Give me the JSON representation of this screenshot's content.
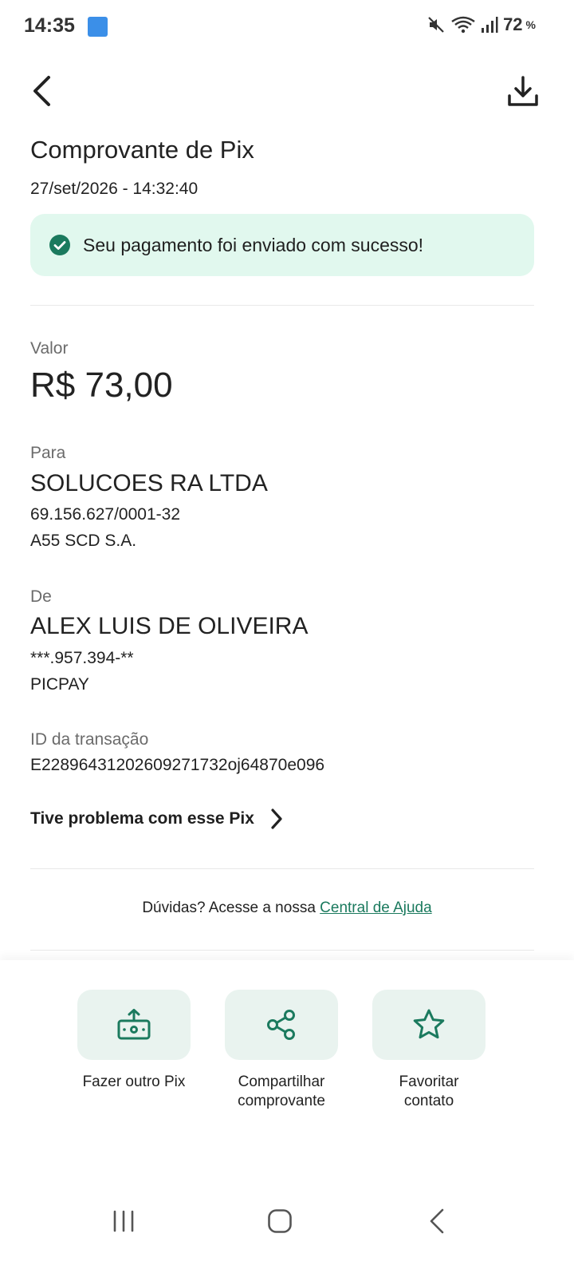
{
  "status_bar": {
    "time": "14:35",
    "battery": "72",
    "battery_unit": "%"
  },
  "header": {
    "title": "Comprovante de Pix",
    "date": "27/set/2026 - 14:32:40"
  },
  "success": {
    "message": "Seu pagamento foi enviado com sucesso!"
  },
  "valor": {
    "label": "Valor",
    "amount": "R$ 73,00"
  },
  "para": {
    "label": "Para",
    "name": "SOLUCOES RA LTDA",
    "document": "69.156.627/0001-32",
    "institution": "A55 SCD S.A."
  },
  "de": {
    "label": "De",
    "name": "ALEX LUIS DE OLIVEIRA",
    "document": "***.957.394-**",
    "institution": "PICPAY"
  },
  "transaction": {
    "label": "ID da transação",
    "id": "E22896431202609271732oj64870e096"
  },
  "problem_link": "Tive problema com esse Pix",
  "help": {
    "prefix": "Dúvidas? Acesse a nossa ",
    "link": "Central de Ajuda"
  },
  "actions": [
    {
      "label_line1": "Fazer outro Pix",
      "label_line2": ""
    },
    {
      "label_line1": "Compartilhar",
      "label_line2": "comprovante"
    },
    {
      "label_line1": "Favoritar",
      "label_line2": "contato"
    }
  ],
  "colors": {
    "accent": "#1b7a5e",
    "success_bg": "#e1f8ee",
    "tile_bg": "#e9f3ef"
  }
}
